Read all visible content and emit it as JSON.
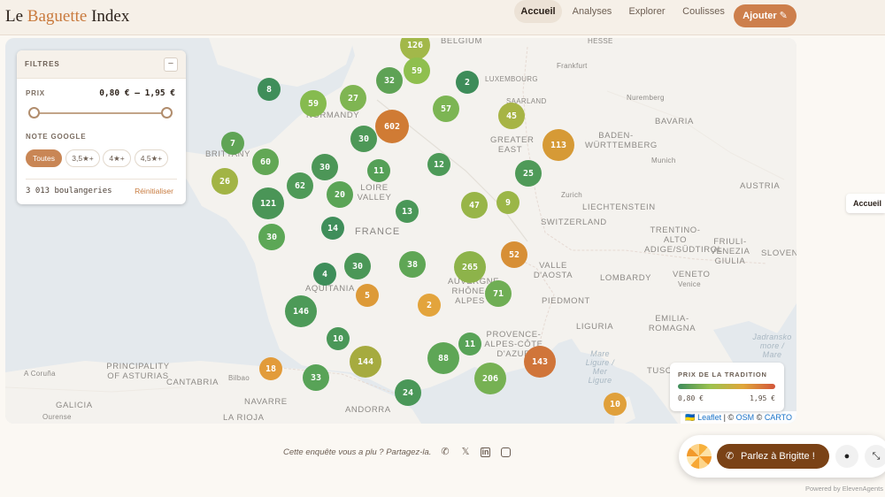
{
  "header": {
    "logo_prefix": "Le ",
    "logo_accent": "Baguette",
    "logo_suffix": " Index",
    "nav": [
      {
        "label": "Accueil",
        "active": true
      },
      {
        "label": "Analyses",
        "active": false
      },
      {
        "label": "Explorer",
        "active": false
      },
      {
        "label": "Coulisses",
        "active": false
      }
    ],
    "add_label": "Ajouter",
    "add_icon": "pencil-icon"
  },
  "filters": {
    "title": "FILTRES",
    "collapse_symbol": "−",
    "price_label": "PRIX",
    "price_range": "0,80 € – 1,95 €",
    "price_min_fraction": 0,
    "price_max_fraction": 1,
    "rating_label": "NOTE GOOGLE",
    "rating_options": [
      {
        "label": "Toutes",
        "active": true
      },
      {
        "label": "3,5★+",
        "active": false
      },
      {
        "label": "4★+",
        "active": false
      },
      {
        "label": "4,5★+",
        "active": false
      }
    ],
    "count": "3 013 boulangeries",
    "reset": "Réinitialiser"
  },
  "map": {
    "places": [
      {
        "text": "BELGIUM",
        "cls": "mid"
      },
      {
        "text": "HESSE",
        "cls": ""
      },
      {
        "text": "Frankfurt",
        "cls": ""
      },
      {
        "text": "LUXEMBOURG",
        "cls": ""
      },
      {
        "text": "SAARLAND",
        "cls": ""
      },
      {
        "text": "Nuremberg",
        "cls": ""
      },
      {
        "text": "BAVARIA",
        "cls": "mid"
      },
      {
        "text": "BADEN-WÜRTTEMBERG",
        "cls": "mid"
      },
      {
        "text": "Munich",
        "cls": ""
      },
      {
        "text": "AUSTRIA",
        "cls": "mid"
      },
      {
        "text": "GREATER EAST",
        "cls": "mid"
      },
      {
        "text": "LIECHTENSTEIN",
        "cls": "mid"
      },
      {
        "text": "Zurich",
        "cls": ""
      },
      {
        "text": "SWITZERLAND",
        "cls": "mid"
      },
      {
        "text": "TRENTINO-ALTO ADIGE/SÜDTIROL",
        "cls": "mid"
      },
      {
        "text": "FRIULI-VENEZIA GIULIA",
        "cls": "mid"
      },
      {
        "text": "SLOVEN",
        "cls": "mid"
      },
      {
        "text": "FRANCE",
        "cls": "big"
      },
      {
        "text": "LOIRE VALLEY",
        "cls": "mid"
      },
      {
        "text": "NORMANDY",
        "cls": "mid"
      },
      {
        "text": "BRITTANY",
        "cls": "mid"
      },
      {
        "text": "AQUITANIA",
        "cls": "mid"
      },
      {
        "text": "VALLE D'AOSTA",
        "cls": "mid"
      },
      {
        "text": "LOMBARDY",
        "cls": "mid"
      },
      {
        "text": "VENETO",
        "cls": "mid"
      },
      {
        "text": "Venice",
        "cls": ""
      },
      {
        "text": "PIEDMONT",
        "cls": "mid"
      },
      {
        "text": "EMILIA-ROMAGNA",
        "cls": "mid"
      },
      {
        "text": "LIGURIA",
        "cls": "mid"
      },
      {
        "text": "TUSCANY",
        "cls": "mid"
      },
      {
        "text": "PROVENCE-ALPES-CÔTE D'AZUR",
        "cls": "mid"
      },
      {
        "text": "AUVERGNE-RHÔNE-ALPES",
        "cls": "mid"
      },
      {
        "text": "PRINCIPALITY OF ASTURIAS",
        "cls": "mid"
      },
      {
        "text": "CANTABRIA",
        "cls": "mid"
      },
      {
        "text": "GALICIA",
        "cls": "mid"
      },
      {
        "text": "NAVARRE",
        "cls": "mid"
      },
      {
        "text": "LA RIOJA",
        "cls": "mid"
      },
      {
        "text": "ANDORRA",
        "cls": "mid"
      },
      {
        "text": "A Coruña",
        "cls": ""
      },
      {
        "text": "Ourense",
        "cls": ""
      },
      {
        "text": "Bilbao",
        "cls": ""
      },
      {
        "text": "Mare Ligure / Mer Ligure",
        "cls": "sea"
      },
      {
        "text": "Jadransko more / Mare",
        "cls": "sea"
      }
    ],
    "clusters": [
      {
        "count": "126",
        "color": "#a2b84a"
      },
      {
        "count": "59",
        "color": "#8fbf4e"
      },
      {
        "count": "2",
        "color": "#3d8c59"
      },
      {
        "count": "8",
        "color": "#3f8e5a"
      },
      {
        "count": "59",
        "color": "#86bb4f"
      },
      {
        "count": "27",
        "color": "#7fb552"
      },
      {
        "count": "32",
        "color": "#5ea255"
      },
      {
        "count": "602",
        "color": "#d07b34"
      },
      {
        "count": "57",
        "color": "#7cb553"
      },
      {
        "count": "45",
        "color": "#a7b445"
      },
      {
        "count": "113",
        "color": "#d69a36"
      },
      {
        "count": "7",
        "color": "#5fa455"
      },
      {
        "count": "30",
        "color": "#4d9857"
      },
      {
        "count": "60",
        "color": "#62a755"
      },
      {
        "count": "30",
        "color": "#4c9657"
      },
      {
        "count": "11",
        "color": "#55a057"
      },
      {
        "count": "12",
        "color": "#4d9a58"
      },
      {
        "count": "25",
        "color": "#4f9a58"
      },
      {
        "count": "26",
        "color": "#a2b445"
      },
      {
        "count": "62",
        "color": "#4f9a58"
      },
      {
        "count": "20",
        "color": "#5ba456"
      },
      {
        "count": "121",
        "color": "#4a9557"
      },
      {
        "count": "13",
        "color": "#4a9758"
      },
      {
        "count": "47",
        "color": "#98b548"
      },
      {
        "count": "9",
        "color": "#9bb647"
      },
      {
        "count": "14",
        "color": "#3f8e5a"
      },
      {
        "count": "30",
        "color": "#5ca756"
      },
      {
        "count": "52",
        "color": "#d78f36"
      },
      {
        "count": "4",
        "color": "#3e8e5a"
      },
      {
        "count": "30",
        "color": "#4b9757"
      },
      {
        "count": "38",
        "color": "#5fa655"
      },
      {
        "count": "265",
        "color": "#8db34a"
      },
      {
        "count": "5",
        "color": "#dd9a38"
      },
      {
        "count": "2",
        "color": "#e3a43c"
      },
      {
        "count": "71",
        "color": "#6fae54"
      },
      {
        "count": "146",
        "color": "#4d9a58"
      },
      {
        "count": "10",
        "color": "#4a9758"
      },
      {
        "count": "11",
        "color": "#58a357"
      },
      {
        "count": "144",
        "color": "#a6ab3f"
      },
      {
        "count": "88",
        "color": "#5ea656"
      },
      {
        "count": "143",
        "color": "#d0753a"
      },
      {
        "count": "18",
        "color": "#e29b3a"
      },
      {
        "count": "33",
        "color": "#58a357"
      },
      {
        "count": "206",
        "color": "#76b153"
      },
      {
        "count": "24",
        "color": "#4a9758"
      },
      {
        "count": "10",
        "color": "#e0a03b"
      }
    ],
    "attribution_leaflet": "Leaflet",
    "attribution_sep1": " | © ",
    "attribution_osm": "OSM",
    "attribution_sep2": " © ",
    "attribution_carto": "CARTO",
    "attribution_flag": "🇺🇦"
  },
  "legend": {
    "title": "PRIX DE LA TRADITION",
    "min": "0,80 €",
    "max": "1,95 €",
    "colors": [
      "#3e8c5b",
      "#9cc24e",
      "#e0a63a",
      "#d2553a"
    ]
  },
  "side_tooltip": "Accueil",
  "share": {
    "text": "Cette enquête vous a plu ? Partagez-la.",
    "icons": [
      "whatsapp-icon",
      "x-icon",
      "linkedin-icon",
      "instagram-icon"
    ]
  },
  "chat": {
    "cta": "Parlez à Brigitte !",
    "powered": "Powered by ElevenAgents"
  }
}
